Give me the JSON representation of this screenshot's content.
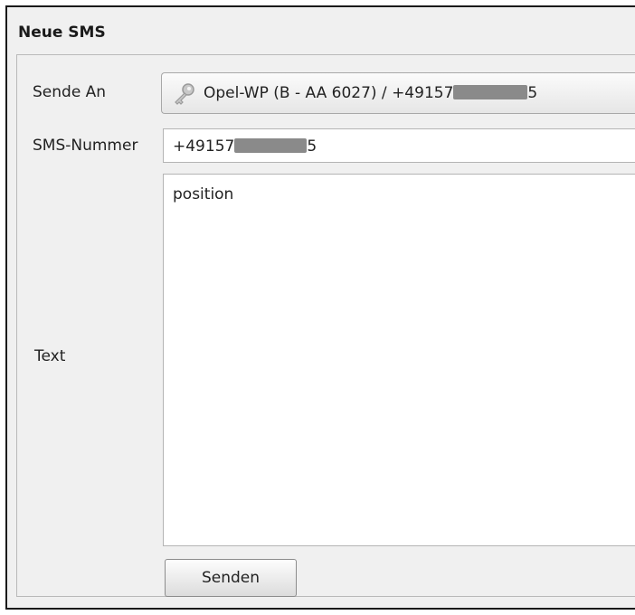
{
  "window": {
    "group_title": "Neue SMS"
  },
  "form": {
    "recipient_label": "Sende An",
    "recipient_value_prefix": "Opel-WP (B - AA 6027) / +49157",
    "recipient_value_suffix": "5",
    "number_label": "SMS-Nummer",
    "number_value_prefix": "+49157",
    "number_value_suffix": "5",
    "text_label": "Text",
    "text_value": "position",
    "send_button": "Senden"
  },
  "icons": {
    "recipient_icon": "key-icon"
  },
  "colors": {
    "redaction": "#8a8a8a",
    "panel_background": "#f0f0f0"
  }
}
